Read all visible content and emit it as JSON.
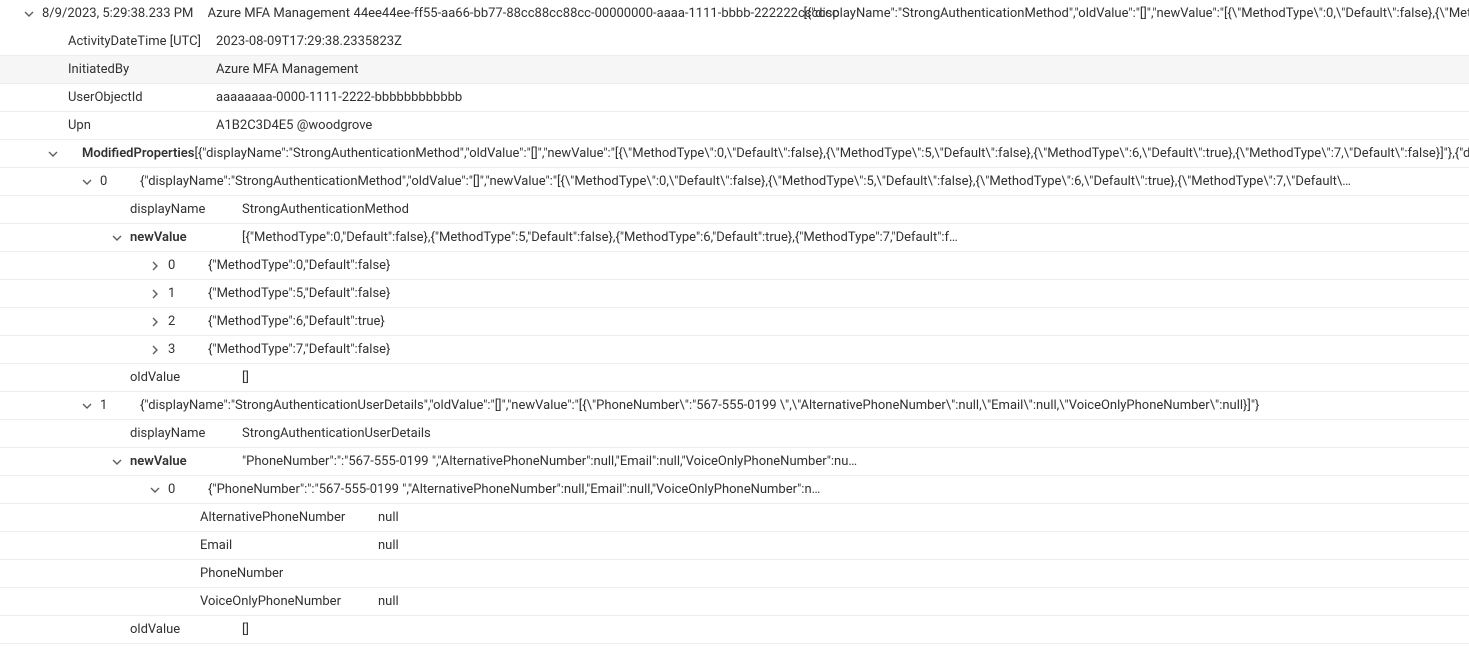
{
  "record": {
    "timestamp_local": "8/9/2023, 5:29:38.233 PM",
    "service": "Azure MFA Management",
    "correlation_id": "44ee44ee-ff55-aa66-bb77-88cc88cc88cc-00000000-aaaa-1111-bbbb-222222cccccc",
    "summary_json": "[{\"displayName\":\"StrongAuthenticationMethod\",\"oldValue\":\"[]\",\"newValue\":\"[{\\\"MethodType\\\":0,\\\"Default\\\":false},{\\\"Meth"
  },
  "props": {
    "activityDateTime_key": "ActivityDateTime [UTC]",
    "activityDateTime_val": "2023-08-09T17:29:38.2335823Z",
    "initiatedBy_key": "InitiatedBy",
    "initiatedBy_val": "Azure MFA Management",
    "userObjectId_key": "UserObjectId",
    "userObjectId_val": "aaaaaaaa-0000-1111-2222-bbbbbbbbbbbb",
    "upn_key": "Upn",
    "upn_val": "A1B2C3D4E5 @woodgrove"
  },
  "modifiedProperties": {
    "key": "ModifiedProperties",
    "summary": "[{\"displayName\":\"StrongAuthenticationMethod\",\"oldValue\":\"[]\",\"newValue\":\"[{\\\"MethodType\\\":0,\\\"Default\\\":false},{\\\"MethodType\\\":5,\\\"Default\\\":false},{\\\"MethodType\\\":6,\\\"Default\\\":true},{\\\"MethodType\\\":7,\\\"Default\\\":false}]\"},{\"d",
    "items": [
      {
        "index": "0",
        "summary": "{\"displayName\":\"StrongAuthenticationMethod\",\"oldValue\":\"[]\",\"newValue\":\"[{\\\"MethodType\\\":0,\\\"Default\\\":false},{\\\"MethodType\\\":5,\\\"Default\\\":false},{\\\"MethodType\\\":6,\\\"Default\\\":true},{\\\"MethodType\\\":7,\\\"Default\\…",
        "displayName_key": "displayName",
        "displayName_val": "StrongAuthenticationMethod",
        "newValue_key": "newValue",
        "newValue_summary": "[{\"MethodType\":0,\"Default\":false},{\"MethodType\":5,\"Default\":false},{\"MethodType\":6,\"Default\":true},{\"MethodType\":7,\"Default\":f…",
        "newValue_items": [
          {
            "index": "0",
            "summary": "{\"MethodType\":0,\"Default\":false}"
          },
          {
            "index": "1",
            "summary": "{\"MethodType\":5,\"Default\":false}"
          },
          {
            "index": "2",
            "summary": "{\"MethodType\":6,\"Default\":true}"
          },
          {
            "index": "3",
            "summary": "{\"MethodType\":7,\"Default\":false}"
          }
        ],
        "oldValue_key": "oldValue",
        "oldValue_val": "[]"
      },
      {
        "index": "1",
        "summary": "{\"displayName\":\"StrongAuthenticationUserDetails\",\"oldValue\":\"[]\",\"newValue\":\"[{\\\"PhoneNumber\\\":\"567-555-0199 \\\",\\\"AlternativePhoneNumber\\\":null,\\\"Email\\\":null,\\\"VoiceOnlyPhoneNumber\\\":null}]\"}",
        "displayName_key": "displayName",
        "displayName_val": "StrongAuthenticationUserDetails",
        "newValue_key": "newValue",
        "newValue_summary": "\"PhoneNumber\":\":\"567-555-0199 \",\"AlternativePhoneNumber\":null,\"Email\":null,\"VoiceOnlyPhoneNumber\":nu…",
        "newValue_items": [
          {
            "index": "0",
            "summary": "{\"PhoneNumber\":\":\"567-555-0199 \",\"AlternativePhoneNumber\":null,\"Email\":null,\"VoiceOnlyPhoneNumber\":n…",
            "fields": [
              {
                "k": "AlternativePhoneNumber",
                "v": "null"
              },
              {
                "k": "Email",
                "v": "null"
              },
              {
                "k": "PhoneNumber",
                "v": ""
              },
              {
                "k": "VoiceOnlyPhoneNumber",
                "v": "null"
              }
            ]
          }
        ],
        "oldValue_key": "oldValue",
        "oldValue_val": "[]"
      }
    ]
  }
}
